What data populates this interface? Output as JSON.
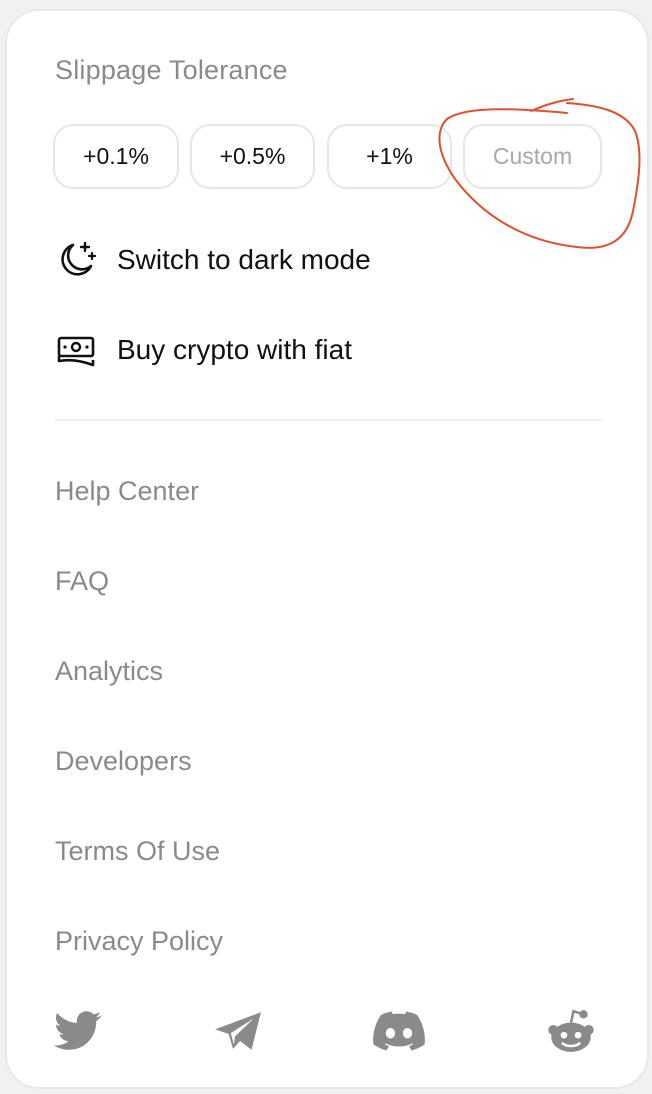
{
  "slippage": {
    "title": "Slippage Tolerance",
    "options": [
      "+0.1%",
      "+0.5%",
      "+1%"
    ],
    "custom_placeholder": "Custom"
  },
  "menu": {
    "dark_mode_label": "Switch to dark mode",
    "buy_crypto_label": "Buy crypto with fiat"
  },
  "links": [
    "Help Center",
    "FAQ",
    "Analytics",
    "Developers",
    "Terms Of Use",
    "Privacy Policy"
  ],
  "social": [
    "twitter-icon",
    "telegram-icon",
    "discord-icon",
    "reddit-icon"
  ],
  "colors": {
    "muted_text": "#8a8a8a",
    "annotation": "#e0502e",
    "icon_gray": "#8a8a8a"
  }
}
